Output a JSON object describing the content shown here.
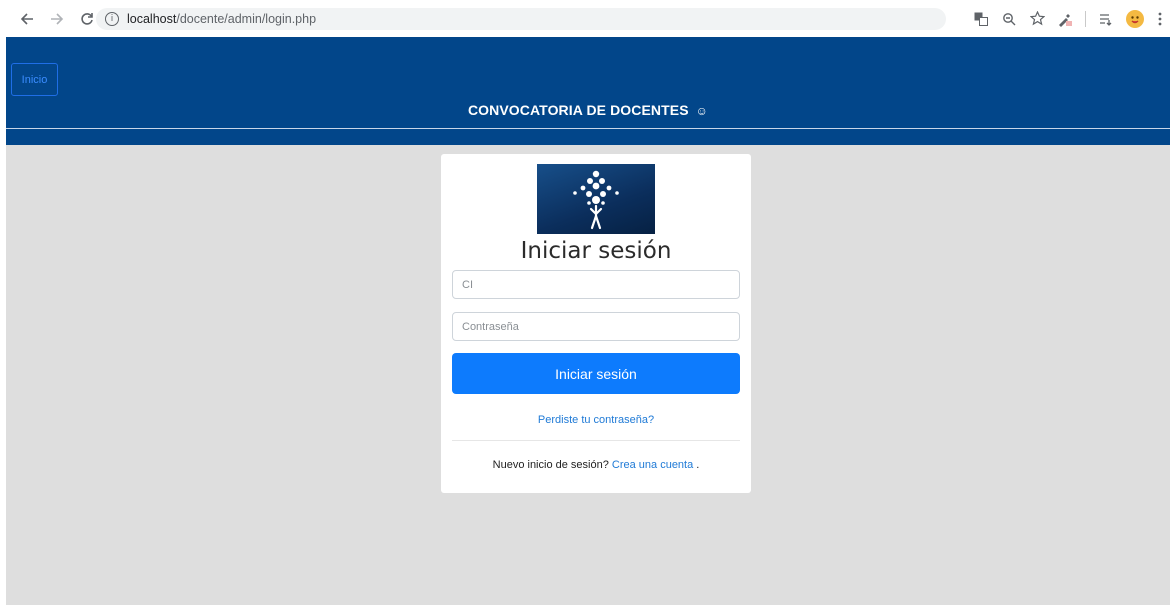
{
  "browser": {
    "url_host": "localhost",
    "url_path": "/docente/admin/login.php",
    "info_glyph": "i"
  },
  "header": {
    "inicio_label": "Inicio",
    "brand": "CONVOCATORIA DE DOCENTES",
    "smile": "☺",
    "background_color": "#02468a"
  },
  "login": {
    "title": "Iniciar sesión",
    "ci_placeholder": "CI",
    "password_placeholder": "Contraseña",
    "submit_label": "Iniciar sesión",
    "forgot_label": "Perdiste tu contraseña?",
    "register_prefix": "Nuevo inicio de sesión?",
    "register_link": "Crea una cuenta",
    "register_suffix": ".",
    "accent_color": "#0d7bfd"
  },
  "icons": [
    "back-arrow-icon",
    "forward-arrow-icon",
    "reload-icon",
    "info-icon",
    "translate-icon",
    "zoom-icon",
    "star-icon",
    "eyedropper-icon",
    "reading-list-icon",
    "profile-avatar-icon",
    "menu-icon",
    "logo-figure-icon"
  ]
}
